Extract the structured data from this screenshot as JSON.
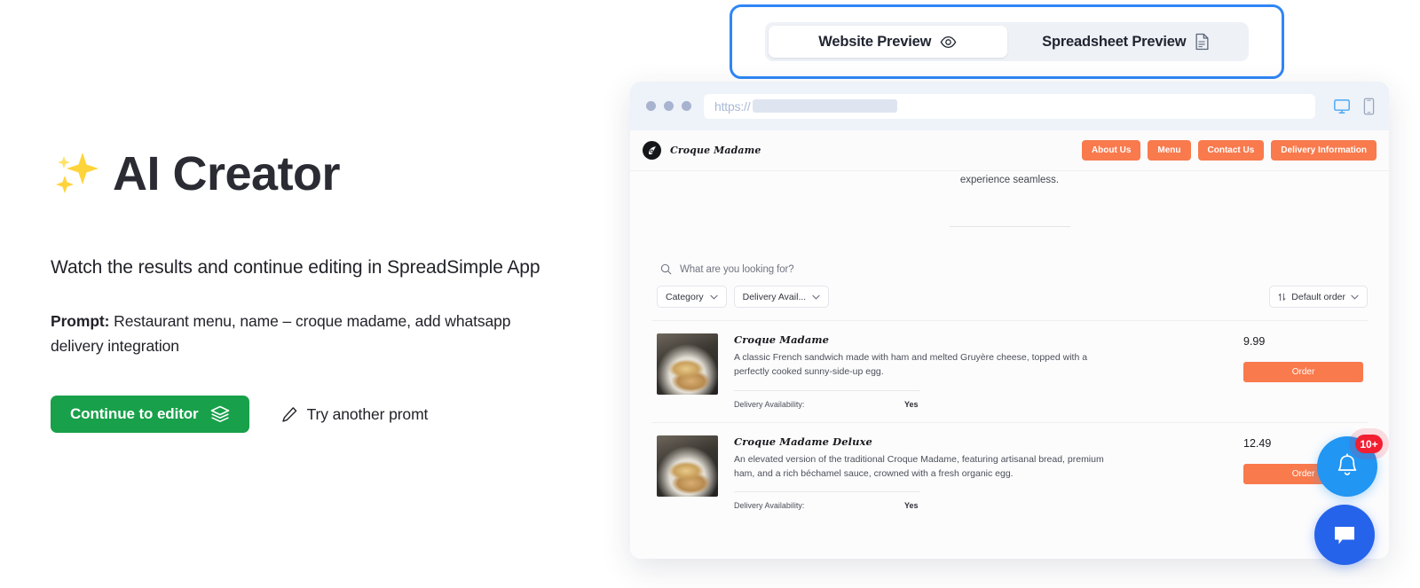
{
  "hero": {
    "sparkle_icon": "sparkles-icon",
    "title": "AI Creator",
    "subtitle": "Watch the results and continue editing in SpreadSimple App",
    "prompt_label": "Prompt:",
    "prompt_text": " Restaurant menu, name – croque madame, add whatsapp delivery integration",
    "continue_button": "Continue to editor",
    "continue_icon": "layers-icon",
    "try_again_button": "Try another promt",
    "try_again_icon": "pencil-icon",
    "accent_green": "#18a04a"
  },
  "preview_toggle": {
    "border_color": "#2f86f6",
    "options": [
      {
        "label": "Website Preview",
        "icon": "eye-icon",
        "active": true
      },
      {
        "label": "Spreadsheet Preview",
        "icon": "document-icon",
        "active": false
      }
    ]
  },
  "browser": {
    "url_protocol": "https://",
    "url_value": "",
    "device_icons": [
      {
        "name": "desktop-icon",
        "active": true
      },
      {
        "name": "mobile-icon",
        "active": false
      }
    ]
  },
  "site": {
    "brand_name": "Croque Madame",
    "logo_icon": "croque-madame-logo-icon",
    "nav": [
      "About Us",
      "Menu",
      "Contact Us",
      "Delivery Information"
    ],
    "nav_color": "#f97a4d",
    "hero_tail_text": "experience seamless.",
    "search": {
      "icon": "search-icon",
      "placeholder": "What are you looking for?",
      "value": ""
    },
    "filters": [
      {
        "label": "Category",
        "icon": "chevron-down-icon"
      },
      {
        "label": "Delivery Avail...",
        "icon": "chevron-down-icon"
      }
    ],
    "sort": {
      "label": "Default order",
      "leading_icon": "sort-arrows-icon",
      "trailing_icon": "chevron-down-icon"
    },
    "products": [
      {
        "name": "Croque Madame",
        "description": "A classic French sandwich made with ham and melted Gruyère cheese, topped with a perfectly cooked sunny-side-up egg.",
        "meta_label": "Delivery Availability:",
        "meta_value": "Yes",
        "price": "9.99",
        "order_label": "Order",
        "image_alt": "croque-madame-photo"
      },
      {
        "name": "Croque Madame Deluxe",
        "description": "An elevated version of the traditional Croque Madame, featuring artisanal bread, premium ham, and a rich béchamel sauce, crowned with a fresh organic egg.",
        "meta_label": "Delivery Availability:",
        "meta_value": "Yes",
        "price": "12.49",
        "order_label": "Order",
        "image_alt": "croque-madame-deluxe-photo"
      }
    ]
  },
  "floating": {
    "bell": {
      "icon": "bell-icon",
      "badge": "10+",
      "badge_color": "#f11f31",
      "color": "#2196f3"
    },
    "chat": {
      "icon": "chat-bubble-icon",
      "color": "#2563eb"
    }
  }
}
